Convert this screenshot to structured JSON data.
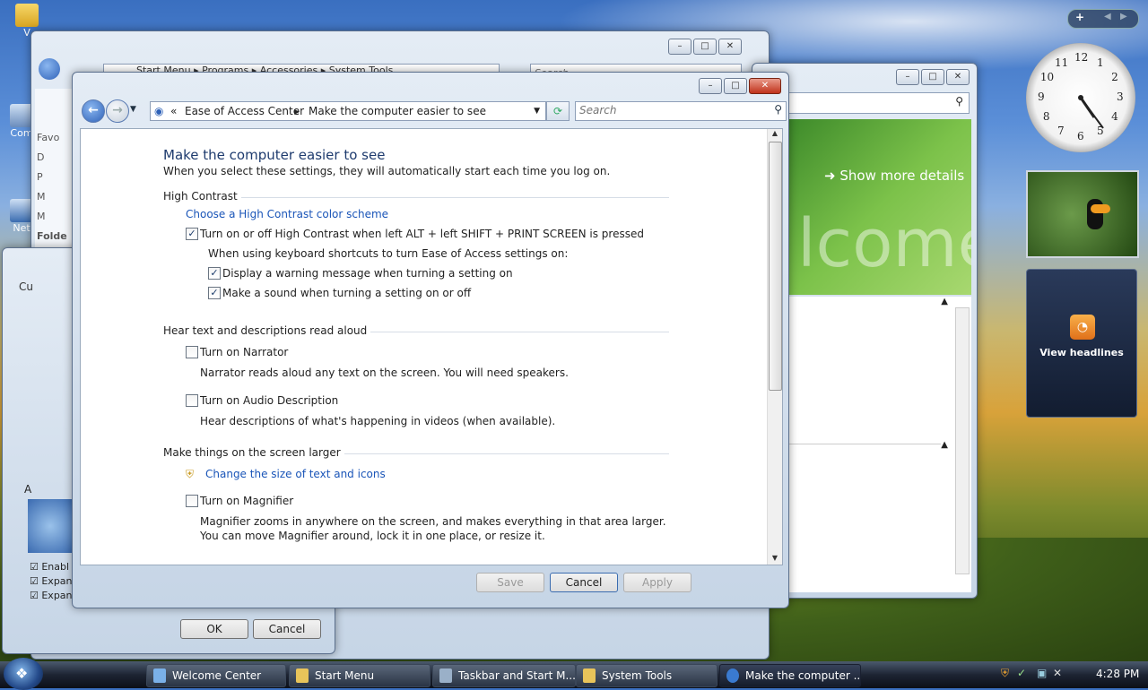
{
  "desktop": {
    "icons": [
      {
        "label": "V"
      },
      {
        "label": "Com"
      },
      {
        "label": "Net"
      }
    ]
  },
  "back_explorer": {
    "breadcrumb": [
      "Start Menu",
      "Programs",
      "Accessories",
      "System Tools"
    ],
    "search_placeholder": "Search",
    "left_labels": [
      "Favo",
      "D",
      "P",
      "M",
      "M",
      "Folde"
    ]
  },
  "back_dialog": {
    "tab_label": "Cu",
    "section_label": "A",
    "checkbox_rows": [
      "Enabl",
      "Expan",
      "Expan"
    ],
    "ok_label": "OK",
    "cancel_label": "Cancel"
  },
  "welcome_window": {
    "show_more": "Show more details",
    "banner_text": "lcome"
  },
  "main_window": {
    "breadcrumb": [
      "Ease of Access Center",
      "Make the computer easier to see"
    ],
    "search_placeholder": "Search",
    "title": "Make the computer easier to see",
    "subtitle": "When you select these settings, they will automatically start each time you log on.",
    "sections": {
      "high_contrast": {
        "heading": "High Contrast",
        "link": "Choose a High Contrast color scheme",
        "toggle_label": "Turn on or off High Contrast when left ALT + left SHIFT + PRINT SCREEN is pressed",
        "toggle_checked": true,
        "shortcut_note": "When using keyboard shortcuts to turn Ease of Access settings on:",
        "warning_label": "Display a warning message when turning a setting on",
        "warning_checked": true,
        "sound_label": "Make a sound when turning a setting on or off",
        "sound_checked": true
      },
      "hear_text": {
        "heading": "Hear text and descriptions read aloud",
        "narrator_label": "Turn on Narrator",
        "narrator_checked": false,
        "narrator_desc": "Narrator reads aloud any text on the screen. You will need speakers.",
        "audio_label": "Turn on Audio Description",
        "audio_checked": false,
        "audio_desc": "Hear descriptions of what's happening in videos (when available)."
      },
      "larger": {
        "heading": "Make things on the screen larger",
        "link": "Change the size of text and icons",
        "magnifier_label": "Turn on Magnifier",
        "magnifier_checked": false,
        "magnifier_desc": "Magnifier zooms in anywhere on the screen, and makes everything in that area larger. You can move Magnifier around, lock it in one place, or resize it."
      }
    },
    "buttons": {
      "save": "Save",
      "cancel": "Cancel",
      "apply": "Apply"
    }
  },
  "gadgets": {
    "clock_numbers": [
      "12",
      "1",
      "2",
      "3",
      "4",
      "5",
      "6",
      "7",
      "8",
      "9",
      "10",
      "11"
    ],
    "rss_label": "View headlines"
  },
  "taskbar": {
    "items": [
      {
        "label": "Welcome Center",
        "active": false
      },
      {
        "label": "Start Menu",
        "active": false
      },
      {
        "label": "Taskbar and Start M...",
        "active": false
      },
      {
        "label": "System Tools",
        "active": false
      },
      {
        "label": "Make the computer ...",
        "active": true
      }
    ],
    "time": "4:28 PM"
  },
  "colors": {
    "link": "#1a55b8",
    "title": "#1e3b6e",
    "close": "#c0321b"
  }
}
